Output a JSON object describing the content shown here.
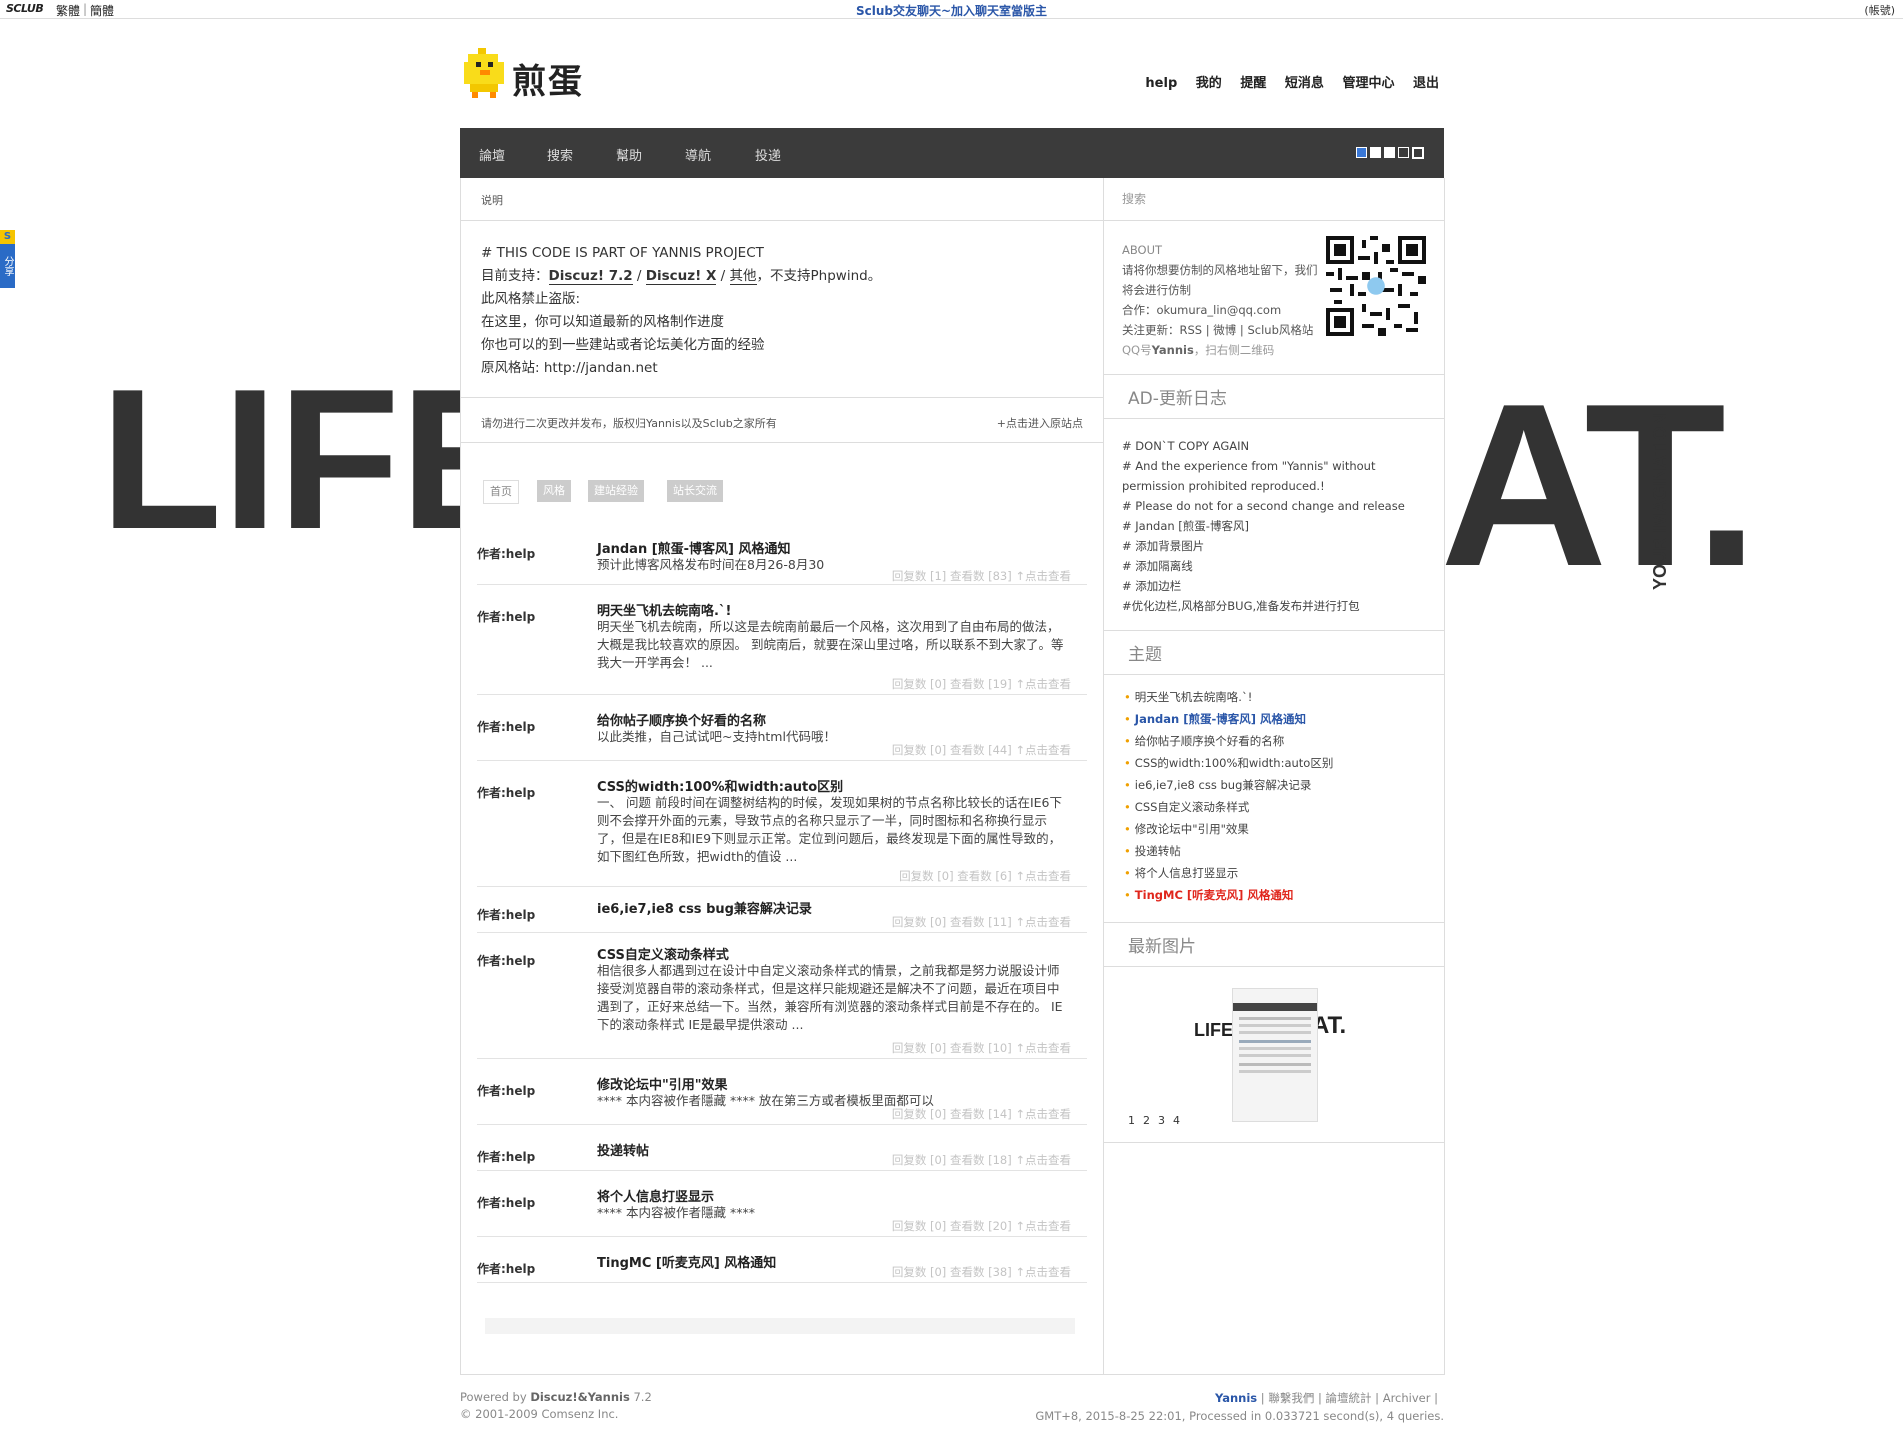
{
  "topbar": {
    "brand": "SCLUB",
    "lang_trad": "繁體",
    "lang_simp": "簡體",
    "announcement": "Sclub交友聊天~加入聊天室當版主",
    "right_link": "(帳號)"
  },
  "share_tab": {
    "label": "分享"
  },
  "background": {
    "left_text": "LIFE",
    "right_text": "AT.",
    "side_text": "YOUR IMAGINATION"
  },
  "logo": {
    "text": "煎蛋"
  },
  "topnav": [
    "help",
    "我的",
    "提醒",
    "短消息",
    "管理中心",
    "退出"
  ],
  "navbar": {
    "items": [
      "論壇",
      "搜索",
      "幫助",
      "導航",
      "投递"
    ]
  },
  "notice": {
    "header": "说明",
    "line1": "# THIS CODE IS PART OF YANNIS PROJECT",
    "line2_prefix": "目前支持：",
    "line2_a": "Discuz! 7.2",
    "line2_sep1": " / ",
    "line2_b": "Discuz! X",
    "line2_sep2": " / ",
    "line2_c": "其他",
    "line2_suffix": "，不支持Phpwind。",
    "line3": "此风格禁止盗版:",
    "line4": "在这里，你可以知道最新的风格制作进度",
    "line5": "你也可以的到一些建站或者论坛美化方面的经验",
    "line6": "原风格站: http://jandan.net",
    "copyright": "请勿进行二次更改并发布，版权归Yannis以及Sclub之家所有",
    "enter_link": "+点击进入原站点"
  },
  "tags": [
    "首页",
    "风格",
    "建站经验",
    "站长交流"
  ],
  "posts": [
    {
      "author": "作者:help",
      "title": "Jandan [煎蛋-博客风] 风格通知",
      "body": "预计此博客风格发布时间在8月26-8月30",
      "meta": "回复数 [1] 查看数 [83] ↑点击查看"
    },
    {
      "author": "作者:help",
      "title": "明天坐飞机去皖南咯.`!",
      "body": "明天坐飞机去皖南，所以这是去皖南前最后一个风格，这次用到了自由布局的做法，大概是我比较喜欢的原因。 到皖南后，就要在深山里过咯，所以联系不到大家了。等我大一开学再会！ ...",
      "meta": "回复数 [0] 查看数 [19] ↑点击查看"
    },
    {
      "author": "作者:help",
      "title": "给你帖子顺序换个好看的名称",
      "body": "以此类推，自己试试吧~支持html代码哦！",
      "meta": "回复数 [0] 查看数 [44] ↑点击查看"
    },
    {
      "author": "作者:help",
      "title": "CSS的width:100%和width:auto区别",
      "body": "一、 问题 前段时间在调整树结构的时候，发现如果树的节点名称比较长的话在IE6下则不会撑开外面的元素，导致节点的名称只显示了一半，同时图标和名称换行显示了，但是在IE8和IE9下则显示正常。定位到问题后，最终发现是下面的属性导致的，如下图红色所致，把width的值设 ...",
      "meta": "回复数 [0] 查看数 [6] ↑点击查看"
    },
    {
      "author": "作者:help",
      "title": "ie6,ie7,ie8 css bug兼容解决记录",
      "body": "",
      "meta": "回复数 [0] 查看数 [11] ↑点击查看"
    },
    {
      "author": "作者:help",
      "title": "CSS自定义滚动条样式",
      "body": "相信很多人都遇到过在设计中自定义滚动条样式的情景，之前我都是努力说服设计师接受浏览器自带的滚动条样式，但是这样只能规避还是解决不了问题，最近在项目中遇到了，正好来总结一下。当然，兼容所有浏览器的滚动条样式目前是不存在的。 IE下的滚动条样式 IE是最早提供滚动 ...",
      "meta": "回复数 [0] 查看数 [10] ↑点击查看"
    },
    {
      "author": "作者:help",
      "title": "修改论坛中\"引用\"效果",
      "body": "**** 本内容被作者隱藏 **** 放在第三方或者模板里面都可以",
      "meta": "回复数 [0] 查看数 [14] ↑点击查看"
    },
    {
      "author": "作者:help",
      "title": "投递转帖",
      "body": "",
      "meta": "回复数 [0] 查看数 [18] ↑点击查看"
    },
    {
      "author": "作者:help",
      "title": "将个人信息打竖显示",
      "body": "**** 本内容被作者隱藏 ****",
      "meta": "回复数 [0] 查看数 [20] ↑点击查看"
    },
    {
      "author": "作者:help",
      "title": "TingMC [听麦克风] 风格通知",
      "body": "",
      "meta": "回复数 [0] 查看数 [38] ↑点击查看"
    }
  ],
  "sidebar": {
    "search_placeholder": "搜索",
    "about_title": "ABOUT",
    "about_line1": "请将你想要仿制的风格地址留下，我们将会进行仿制",
    "about_line2": "合作：okumura_lin@qq.com",
    "about_line3": "关注更新：RSS | 微博 | Sclub风格站",
    "about_line4_prefix": "QQ号",
    "about_line4_name": "Yannis",
    "about_line4_suffix": "，扫右侧二维码",
    "log_title": "AD-更新日志",
    "log_lines": [
      "# DON`T COPY AGAIN",
      "# And the experience from \"Yannis\" without permission prohibited reproduced.!",
      "# Please do not for a second change and release",
      "# Jandan [煎蛋-博客风]",
      "# 添加背景图片",
      "# 添加隔离线",
      "# 添加边栏",
      "#优化边栏,风格部分BUG,准备发布并进行打包"
    ],
    "topics_title": "主题",
    "topics": [
      "明天坐飞机去皖南咯.`!",
      "Jandan [煎蛋-博客风] 风格通知",
      "给你帖子顺序换个好看的名称",
      "CSS的width:100%和width:auto区别",
      "ie6,ie7,ie8 css bug兼容解决记录",
      "CSS自定义滚动条样式",
      "修改论坛中\"引用\"效果",
      "投递转帖",
      "将个人信息打竖显示",
      "TingMC [听麦克风] 风格通知"
    ],
    "images_title": "最新图片",
    "image_pages": [
      "1",
      "2",
      "3",
      "4"
    ],
    "thumb_left": "LIFE",
    "thumb_right": "AT."
  },
  "footer": {
    "powered_prefix": "Powered by ",
    "powered_brand": "Discuz!&Yannis",
    "powered_version": " 7.2",
    "copyright": "© 2001-2009 Comsenz Inc.",
    "links": [
      "Yannis",
      "聯繫我們",
      "論壇統計",
      "Archiver"
    ],
    "stats": "GMT+8, 2015-8-25 22:01, Processed in 0.033721 second(s), 4 queries."
  },
  "colors": {
    "nav_bg": "#3b3b3b",
    "link_blue": "#2a56a8",
    "highlight_red": "#e0261c",
    "bullet": "#f0a000"
  }
}
